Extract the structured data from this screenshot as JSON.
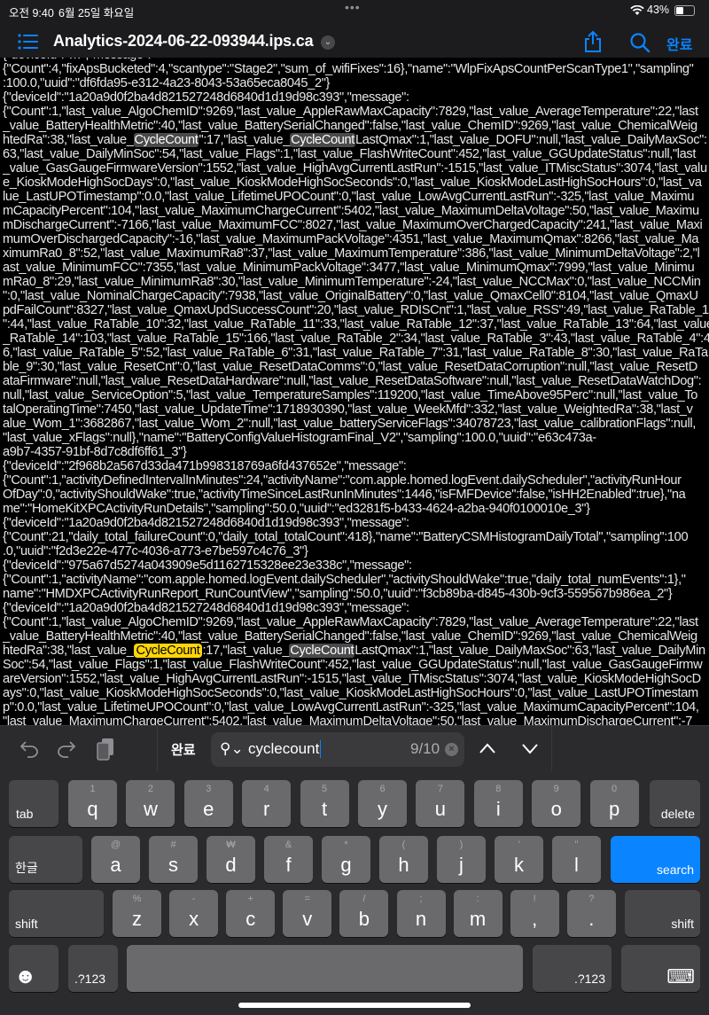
{
  "status_bar": {
    "time": "오전 9:40",
    "date": "6월 25일 화요일",
    "battery": "43%"
  },
  "header": {
    "title": "Analytics-2024-06-22-093944.ips.ca",
    "done": "완료"
  },
  "log_lines": [
    [
      {
        "t": "{\"deviceId\":\"…\",\"message\":"
      }
    ],
    [
      {
        "t": "{\"Count\":4,\"fixApsBucketed\":4,\"scantype\":\"Stage2\",\"sum_of_wifiFixes\":16},\"name\":\"WlpFixApsCountPerScanType1\",\"sampling\""
      }
    ],
    [
      {
        "t": ":100.0,\"uuid\":\"df6fda95-e312-4a23-8043-53a65eca8045_2\"}"
      }
    ],
    [
      {
        "t": "{\"deviceId\":\"1a20a9d0f2ba4d821527248d6840d1d19d98c393\",\"message\":"
      }
    ],
    [
      {
        "t": "{\"Count\":1,\"last_value_AlgoChemID\":9269,\"last_value_AppleRawMaxCapacity\":7829,\"last_value_AverageTemperature\":22,\"last"
      }
    ],
    [
      {
        "t": "_value_BatteryHealthMetric\":40,\"last_value_BatterySerialChanged\":false,\"last_value_ChemID\":9269,\"last_value_ChemicalWeig"
      }
    ],
    [
      {
        "t": "htedRa\":38,\"last_value_"
      },
      {
        "t": "CycleCount",
        "hl": "match"
      },
      {
        "t": "\":17,\"last_value_"
      },
      {
        "t": "CycleCount",
        "hl": "match"
      },
      {
        "t": "LastQmax\":1,\"last_value_DOFU\":null,\"last_value_DailyMaxSoc\":"
      }
    ],
    [
      {
        "t": "63,\"last_value_DailyMinSoc\":54,\"last_value_Flags\":1,\"last_value_FlashWriteCount\":452,\"last_value_GGUpdateStatus\":null,\"last"
      }
    ],
    [
      {
        "t": "_value_GasGaugeFirmwareVersion\":1552,\"last_value_HighAvgCurrentLastRun\":-1515,\"last_value_ITMiscStatus\":3074,\"last_valu"
      }
    ],
    [
      {
        "t": "e_KioskModeHighSocDays\":0,\"last_value_KioskModeHighSocSeconds\":0,\"last_value_KioskModeLastHighSocHours\":0,\"last_va"
      }
    ],
    [
      {
        "t": "lue_LastUPOTimestamp\":0.0,\"last_value_LifetimeUPOCount\":0,\"last_value_LowAvgCurrentLastRun\":-325,\"last_value_Maximu"
      }
    ],
    [
      {
        "t": "mCapacityPercent\":104,\"last_value_MaximumChargeCurrent\":5402,\"last_value_MaximumDeltaVoltage\":50,\"last_value_Maximu"
      }
    ],
    [
      {
        "t": "mDischargeCurrent\":-7166,\"last_value_MaximumFCC\":8027,\"last_value_MaximumOverChargedCapacity\":241,\"last_value_Maxi"
      }
    ],
    [
      {
        "t": "mumOverDischargedCapacity\":-16,\"last_value_MaximumPackVoltage\":4351,\"last_value_MaximumQmax\":8266,\"last_value_Ma"
      }
    ],
    [
      {
        "t": "ximumRa0_8\":52,\"last_value_MaximumRa8\":37,\"last_value_MaximumTemperature\":386,\"last_value_MinimumDeltaVoltage\":2,\"l"
      }
    ],
    [
      {
        "t": "ast_value_MinimumFCC\":7355,\"last_value_MinimumPackVoltage\":3477,\"last_value_MinimumQmax\":7999,\"last_value_Minimu"
      }
    ],
    [
      {
        "t": "mRa0_8\":29,\"last_value_MinimumRa8\":30,\"last_value_MinimumTemperature\":-24,\"last_value_NCCMax\":0,\"last_value_NCCMin"
      }
    ],
    [
      {
        "t": "\":0,\"last_value_NominalChargeCapacity\":7938,\"last_value_OriginalBattery\":0,\"last_value_QmaxCell0\":8104,\"last_value_QmaxU"
      }
    ],
    [
      {
        "t": "pdFailCount\":8327,\"last_value_QmaxUpdSuccessCount\":20,\"last_value_RDISCnt\":1,\"last_value_RSS\":49,\"last_value_RaTable_1"
      }
    ],
    [
      {
        "t": "\":44,\"last_value_RaTable_10\":32,\"last_value_RaTable_11\":33,\"last_value_RaTable_12\":37,\"last_value_RaTable_13\":64,\"last_value"
      }
    ],
    [
      {
        "t": "_RaTable_14\":103,\"last_value_RaTable_15\":166,\"last_value_RaTable_2\":34,\"last_value_RaTable_3\":43,\"last_value_RaTable_4\":4"
      }
    ],
    [
      {
        "t": "6,\"last_value_RaTable_5\":52,\"last_value_RaTable_6\":31,\"last_value_RaTable_7\":31,\"last_value_RaTable_8\":30,\"last_value_RaTa"
      }
    ],
    [
      {
        "t": "ble_9\":30,\"last_value_ResetCnt\":0,\"last_value_ResetDataComms\":0,\"last_value_ResetDataCorruption\":null,\"last_value_ResetD"
      }
    ],
    [
      {
        "t": "ataFirmware\":null,\"last_value_ResetDataHardware\":null,\"last_value_ResetDataSoftware\":null,\"last_value_ResetDataWatchDog\":"
      }
    ],
    [
      {
        "t": "null,\"last_value_ServiceOption\":5,\"last_value_TemperatureSamples\":119200,\"last_value_TimeAbove95Perc\":null,\"last_value_To"
      }
    ],
    [
      {
        "t": "talOperatingTime\":7450,\"last_value_UpdateTime\":1718930390,\"last_value_WeekMfd\":332,\"last_value_WeightedRa\":38,\"last_v"
      }
    ],
    [
      {
        "t": "alue_Wom_1\":3682867,\"last_value_Wom_2\":null,\"last_value_batteryServiceFlags\":34078723,\"last_value_calibrationFlags\":null,"
      }
    ],
    [
      {
        "t": "\"last_value_xFlags\":null},\"name\":\"BatteryConfigValueHistogramFinal_V2\",\"sampling\":100.0,\"uuid\":\"e63c473a-"
      }
    ],
    [
      {
        "t": "a9b7-4357-91bf-8d7c8df6ff61_3\"}"
      }
    ],
    [
      {
        "t": "{\"deviceId\":\"2f968b2a567d33da471b998318769a6fd437652e\",\"message\":"
      }
    ],
    [
      {
        "t": "{\"Count\":1,\"activityDefinedIntervalInMinutes\":24,\"activityName\":\"com.apple.homed.logEvent.dailyScheduler\",\"activityRunHour"
      }
    ],
    [
      {
        "t": "OfDay\":0,\"activityShouldWake\":true,\"activityTimeSinceLastRunInMinutes\":1446,\"isFMFDevice\":false,\"isHH2Enabled\":true},\"na"
      }
    ],
    [
      {
        "t": "me\":\"HomeKitXPCActivityRunDetails\",\"sampling\":50.0,\"uuid\":\"ed3281f5-b433-4624-a2ba-940f0100010e_3\"}"
      }
    ],
    [
      {
        "t": "{\"deviceId\":\"1a20a9d0f2ba4d821527248d6840d1d19d98c393\",\"message\":"
      }
    ],
    [
      {
        "t": "{\"Count\":21,\"daily_total_failureCount\":0,\"daily_total_totalCount\":418},\"name\":\"BatteryCSMHistogramDailyTotal\",\"sampling\":100"
      }
    ],
    [
      {
        "t": ".0,\"uuid\":\"f2d3e22e-477c-4036-a773-e7be597c4c76_3\"}"
      }
    ],
    [
      {
        "t": "{\"deviceId\":\"975a67d5274a043909e5d1162715328ee23e338c\",\"message\":"
      }
    ],
    [
      {
        "t": "{\"Count\":1,\"activityName\":\"com.apple.homed.logEvent.dailyScheduler\",\"activityShouldWake\":true,\"daily_total_numEvents\":1},\""
      }
    ],
    [
      {
        "t": "name\":\"HMDXPCActivityRunReport_RunCountView\",\"sampling\":50.0,\"uuid\":\"f3cb89ba-d845-430b-9cf3-559567b986ea_2\"}"
      }
    ],
    [
      {
        "t": "{\"deviceId\":\"1a20a9d0f2ba4d821527248d6840d1d19d98c393\",\"message\":"
      }
    ],
    [
      {
        "t": "{\"Count\":1,\"last_value_AlgoChemID\":9269,\"last_value_AppleRawMaxCapacity\":7829,\"last_value_AverageTemperature\":22,\"last"
      }
    ],
    [
      {
        "t": "_value_BatteryHealthMetric\":40,\"last_value_BatterySerialChanged\":false,\"last_value_ChemID\":9269,\"last_value_ChemicalWeig"
      }
    ],
    [
      {
        "t": "htedRa\":38,\"last_value_"
      },
      {
        "t": "CycleCount",
        "hl": "current"
      },
      {
        "t": ":17,\"last_value_"
      },
      {
        "t": "CycleCount",
        "hl": "match"
      },
      {
        "t": "LastQmax\":1,\"last_value_DailyMaxSoc\":63,\"last_value_DailyMin"
      }
    ],
    [
      {
        "t": "Soc\":54,\"last_value_Flags\":1,\"last_value_FlashWriteCount\":452,\"last_value_GGUpdateStatus\":null,\"last_value_GasGaugeFirmw"
      }
    ],
    [
      {
        "t": "areVersion\":1552,\"last_value_HighAvgCurrentLastRun\":-1515,\"last_value_ITMiscStatus\":3074,\"last_value_KioskModeHighSocD"
      }
    ],
    [
      {
        "t": "ays\":0,\"last_value_KioskModeHighSocSeconds\":0,\"last_value_KioskModeLastHighSocHours\":0,\"last_value_LastUPOTimestam"
      }
    ],
    [
      {
        "t": "p\":0.0,\"last_value_LifetimeUPOCount\":0,\"last_value_LowAvgCurrentLastRun\":-325,\"last_value_MaximumCapacityPercent\":104,"
      }
    ],
    [
      {
        "t": "\"last_value_MaximumChargeCurrent\":5402,\"last_value_MaximumDeltaVoltage\":50,\"last_value_MaximumDischargeCurrent\":-7"
      }
    ]
  ],
  "find_bar": {
    "done": "완료",
    "query": "cyclecount",
    "count": "9/10"
  },
  "keyboard": {
    "row1": [
      [
        "1",
        "q"
      ],
      [
        "2",
        "w"
      ],
      [
        "3",
        "e"
      ],
      [
        "4",
        "r"
      ],
      [
        "5",
        "t"
      ],
      [
        "6",
        "y"
      ],
      [
        "7",
        "u"
      ],
      [
        "8",
        "i"
      ],
      [
        "9",
        "o"
      ],
      [
        "0",
        "p"
      ]
    ],
    "row2": [
      [
        "@",
        "a"
      ],
      [
        "#",
        "s"
      ],
      [
        "₩",
        "d"
      ],
      [
        "&",
        "f"
      ],
      [
        "*",
        "g"
      ],
      [
        "(",
        "h"
      ],
      [
        ")",
        "j"
      ],
      [
        "'",
        "k"
      ],
      [
        "\"",
        "l"
      ]
    ],
    "row3": [
      [
        "%",
        "z"
      ],
      [
        "-",
        "x"
      ],
      [
        "+",
        "c"
      ],
      [
        "=",
        "v"
      ],
      [
        "/",
        "b"
      ],
      [
        ";",
        "n"
      ],
      [
        ":",
        "m"
      ],
      [
        "!",
        ","
      ],
      [
        "?",
        "."
      ]
    ],
    "tab": "tab",
    "delete": "delete",
    "hangul": "한글",
    "search": "search",
    "shift": "shift",
    "numbers": ".?123"
  },
  "colors": {
    "accent": "#0a84ff",
    "current_match": "#ffd60a",
    "match": "#4a4a4c"
  }
}
